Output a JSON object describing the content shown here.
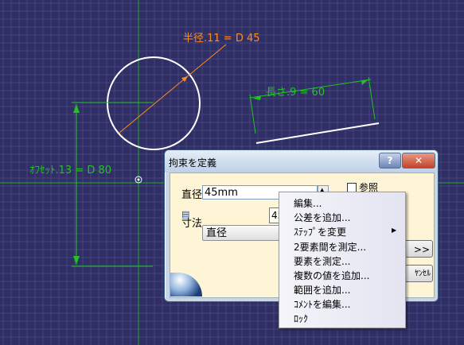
{
  "canvas": {
    "background": "#2f2f66",
    "grid_color": "#44447a",
    "constraint_color": "#21c321",
    "radius_color": "#ff8c1a",
    "radius_dimension": "半径.11 = D 45",
    "length_dimension": "長さ.9 = 60",
    "offset_dimension": "ｵﾌｾｯﾄ.13 = D 80"
  },
  "dialog": {
    "title": "拘束を定義",
    "help_label": "?",
    "close_label": "✕",
    "diameter_label": "直径",
    "diameter_value": "45mm",
    "tooltip_value": "45mm",
    "dimension_label": "寸法",
    "dimension_select": "直径",
    "reference_label": "参照",
    "more_label": ">>",
    "cancel_label": "ﾔﾝｾﾙ"
  },
  "context_menu": {
    "items": [
      "編集...",
      "公差を追加...",
      "ｽﾃｯﾌﾟを変更",
      "2要素間を測定...",
      "要素を測定...",
      "複数の値を追加...",
      "範囲を追加...",
      "ｺﾒﾝﾄを編集...",
      "ﾛｯｸ"
    ],
    "submenu_arrow": "▶"
  }
}
